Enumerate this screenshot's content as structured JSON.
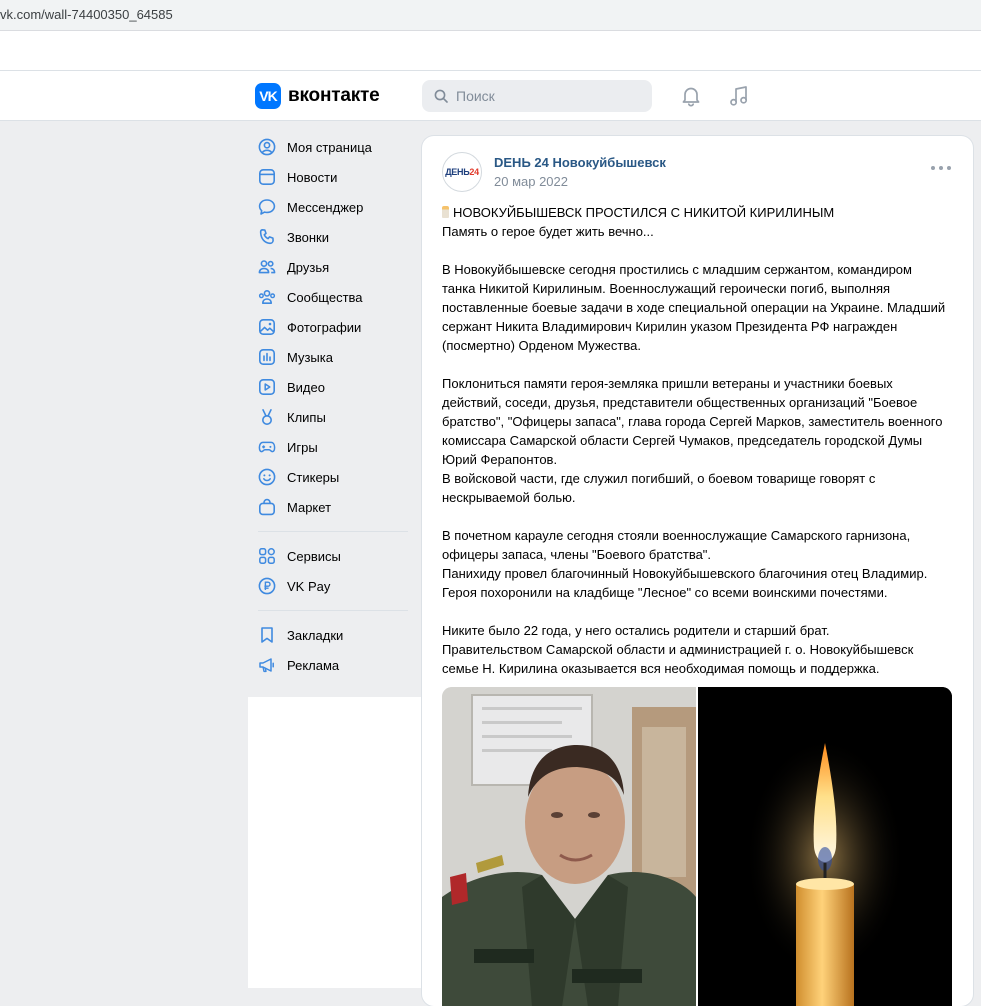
{
  "browser": {
    "url": "vk.com/wall-74400350_64585"
  },
  "header": {
    "logo_mark": "VK",
    "logo_text": "вконтакте",
    "search_placeholder": "Поиск",
    "icons": [
      "bell-icon",
      "music-icon"
    ]
  },
  "sidebar": {
    "items": [
      {
        "label": "Моя страница",
        "icon": "user-circle-icon"
      },
      {
        "label": "Новости",
        "icon": "news-icon"
      },
      {
        "label": "Мессенджер",
        "icon": "message-icon"
      },
      {
        "label": "Звонки",
        "icon": "phone-icon"
      },
      {
        "label": "Друзья",
        "icon": "friends-icon"
      },
      {
        "label": "Сообщества",
        "icon": "communities-icon"
      },
      {
        "label": "Фотографии",
        "icon": "photo-icon"
      },
      {
        "label": "Музыка",
        "icon": "music-icon"
      },
      {
        "label": "Видео",
        "icon": "video-icon"
      },
      {
        "label": "Клипы",
        "icon": "clips-icon"
      },
      {
        "label": "Игры",
        "icon": "gamepad-icon"
      },
      {
        "label": "Стикеры",
        "icon": "smile-icon"
      },
      {
        "label": "Маркет",
        "icon": "market-icon"
      }
    ],
    "services": [
      {
        "label": "Сервисы",
        "icon": "services-icon"
      },
      {
        "label": "VK Pay",
        "icon": "vkpay-icon"
      }
    ],
    "extra": [
      {
        "label": "Закладки",
        "icon": "bookmark-icon"
      },
      {
        "label": "Реклама",
        "icon": "megaphone-icon"
      }
    ]
  },
  "post": {
    "avatar_text_a": "ДЕНЬ",
    "avatar_text_b": "24",
    "group_name": "DEНЬ 24 Новокуйбышевск",
    "date": "20 мар 2022",
    "lines": [
      "НОВОКУЙБЫШЕВСК ПРОСТИЛСЯ С НИКИТОЙ КИРИЛИНЫМ",
      "Память о герое будет жить вечно...",
      "",
      "В Новокуйбышевске сегодня простились с младшим сержантом, командиром",
      "танка Никитой Кирилиным. Военнослужащий героически погиб, выполняя",
      "поставленные боевые задачи в ходе специальной операции на Украине. Младший",
      "сержант Никита Владимирович Кирилин указом Президента РФ награжден",
      "(посмертно) Орденом Мужества.",
      "",
      "Поклониться памяти героя-земляка пришли ветераны и участники боевых",
      "действий, соседи, друзья, представители общественных организаций \"Боевое",
      "братство\", \"Офицеры запаса\", глава города Сергей Марков, заместитель военного",
      "комиссара Самарской области Сергей Чумаков, председатель городской Думы",
      "Юрий Ферапонтов.",
      "В войсковой части, где служил погибший, о боевом товарище говорят с",
      "нескрываемой болью.",
      "",
      "В почетном карауле сегодня стояли военнослужащие Самарского гарнизона,",
      "офицеры запаса, члены \"Боевого братства\".",
      "Панихиду провел благочинный Новокуйбышевского благочиния отец Владимир.",
      "Героя похоронили на кладбище \"Лесное\" со всеми воинскими почестями.",
      "",
      "Никите было 22 года, у него остались родители и старший брат.",
      "Правительством Самарской области и администрацией г. о. Новокуйбышевск",
      "семье Н. Кирилина оказывается вся необходимая помощь и поддержка."
    ]
  },
  "colors": {
    "accent": "#0077ff",
    "link": "#2a5885",
    "muted": "#818c99",
    "icon": "#3f8ae0",
    "page_bg": "#edeef0"
  }
}
